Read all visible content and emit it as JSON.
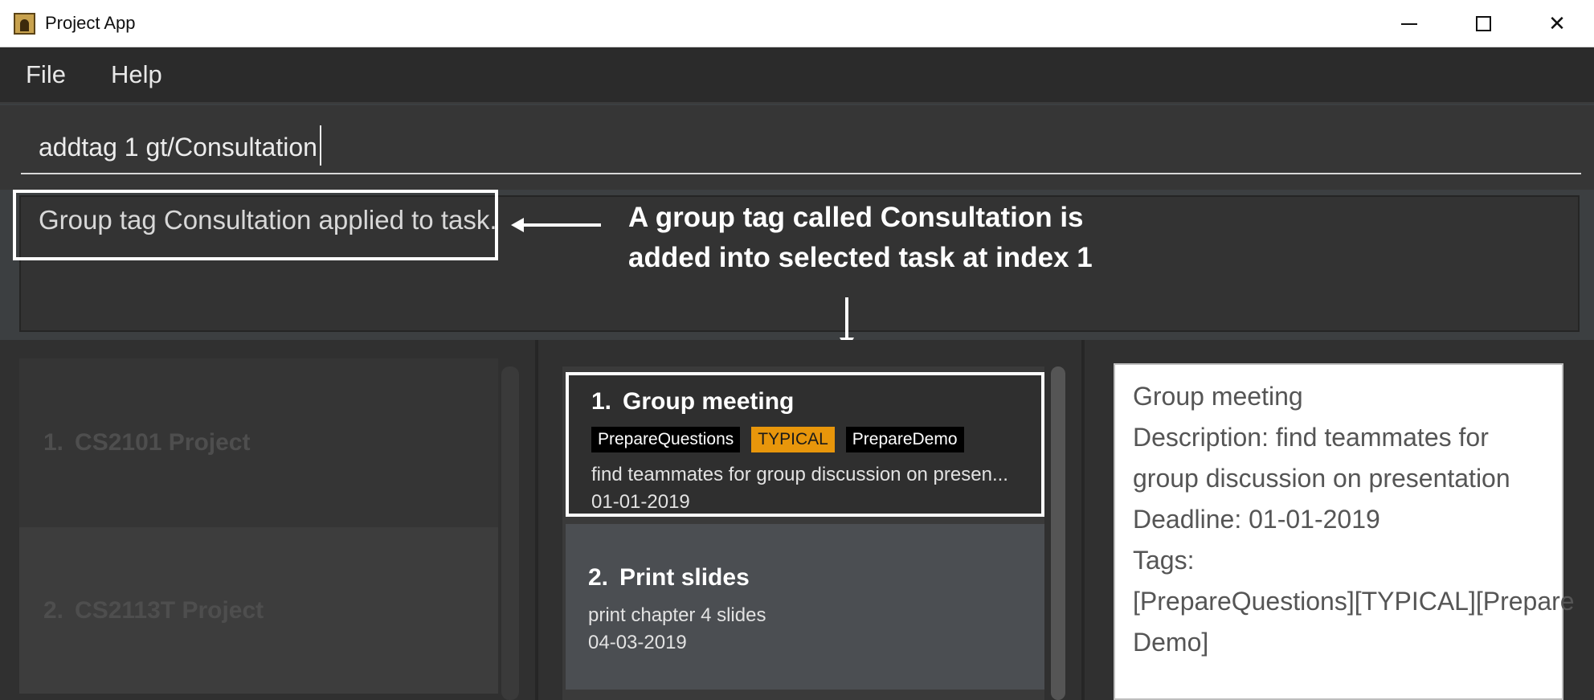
{
  "window": {
    "title": "Project App",
    "minimize_label": "",
    "close_label": "✕"
  },
  "menu": {
    "items": [
      "File",
      "Help"
    ]
  },
  "command": {
    "value": "addtag 1 gt/Consultation"
  },
  "result": {
    "text": "Group tag Consultation applied to task."
  },
  "annotation": {
    "line1": "A group tag called Consultation is",
    "line2": "added into selected task at index 1"
  },
  "projects": [
    {
      "index": "1.",
      "name": "CS2101 Project"
    },
    {
      "index": "2.",
      "name": "CS2113T Project"
    }
  ],
  "tasks": [
    {
      "index": "1.",
      "name": "Group meeting",
      "tags": [
        "PrepareQuestions",
        "TYPICAL",
        "PrepareDemo"
      ],
      "description": "find teammates for group discussion on presen...",
      "date": "01-01-2019"
    },
    {
      "index": "2.",
      "name": "Print slides",
      "tags": [],
      "description": "print chapter 4 slides",
      "date": "04-03-2019"
    }
  ],
  "detail": {
    "lines": [
      "Group meeting",
      "Description: find teammates for",
      "group discussion on presentation",
      "Deadline: 01-01-2019",
      "Tags:",
      "[PrepareQuestions][TYPICAL][Prepare",
      "Demo]"
    ]
  },
  "colors": {
    "tag_default": "#000000",
    "tag_typical": "#e8960b",
    "selected_border": "#ffffff",
    "background": "#3c3f41"
  }
}
